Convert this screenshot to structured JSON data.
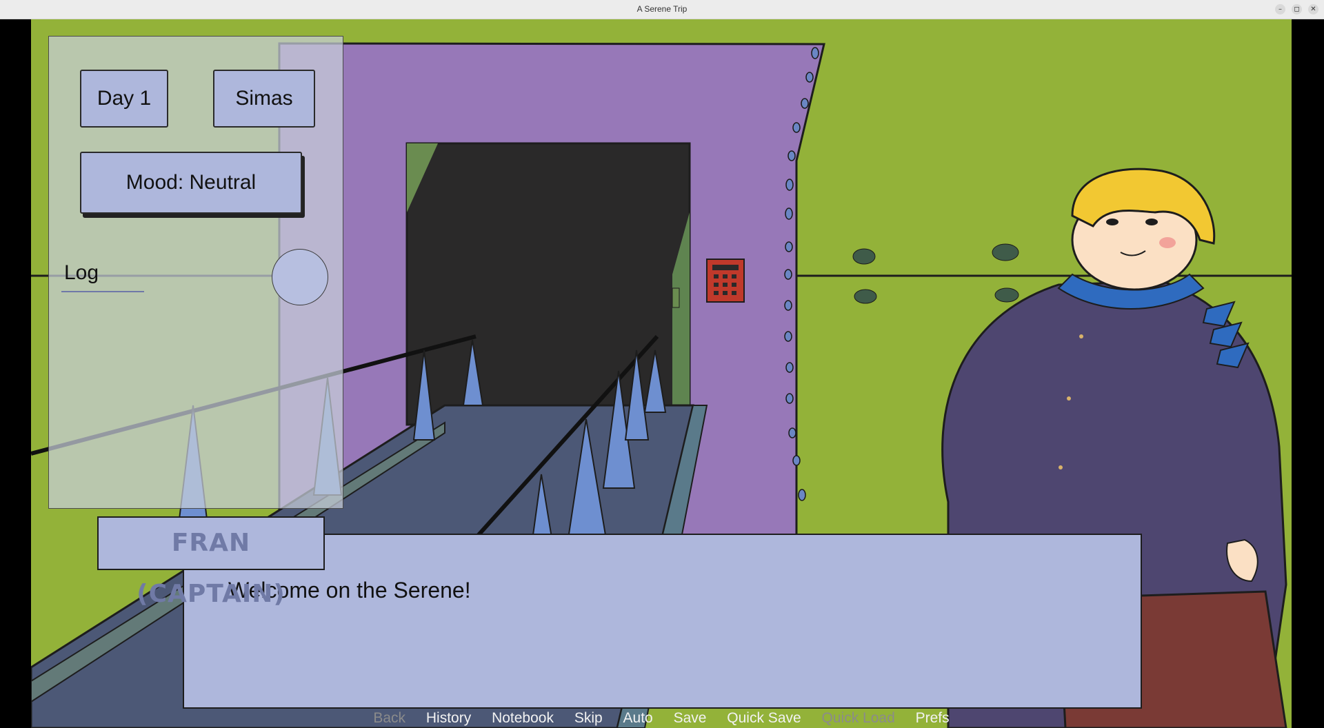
{
  "window": {
    "title": "A Serene Trip",
    "buttons": [
      "–",
      "◻",
      "✕"
    ]
  },
  "hud": {
    "day_label": "Day 1",
    "name_label": "Simas",
    "mood_label": "Mood: Neutral",
    "log_label": "Log"
  },
  "dialogue": {
    "speaker": "FRAN (CAPTAIN)",
    "text": "Welcome on the Serene!"
  },
  "quick_menu": {
    "back": "Back",
    "history": "History",
    "notebook": "Notebook",
    "skip": "Skip",
    "auto": "Auto",
    "save": "Save",
    "quick_save": "Quick Save",
    "quick_load": "Quick Load",
    "prefs": "Prefs"
  },
  "colors": {
    "background_green": "#93b239",
    "wall_purple": "#9778b8",
    "ui_box": "#aeb7dc",
    "speaker_text": "#707aa6",
    "uniform": "#4e4670",
    "hair": "#f2c832"
  }
}
